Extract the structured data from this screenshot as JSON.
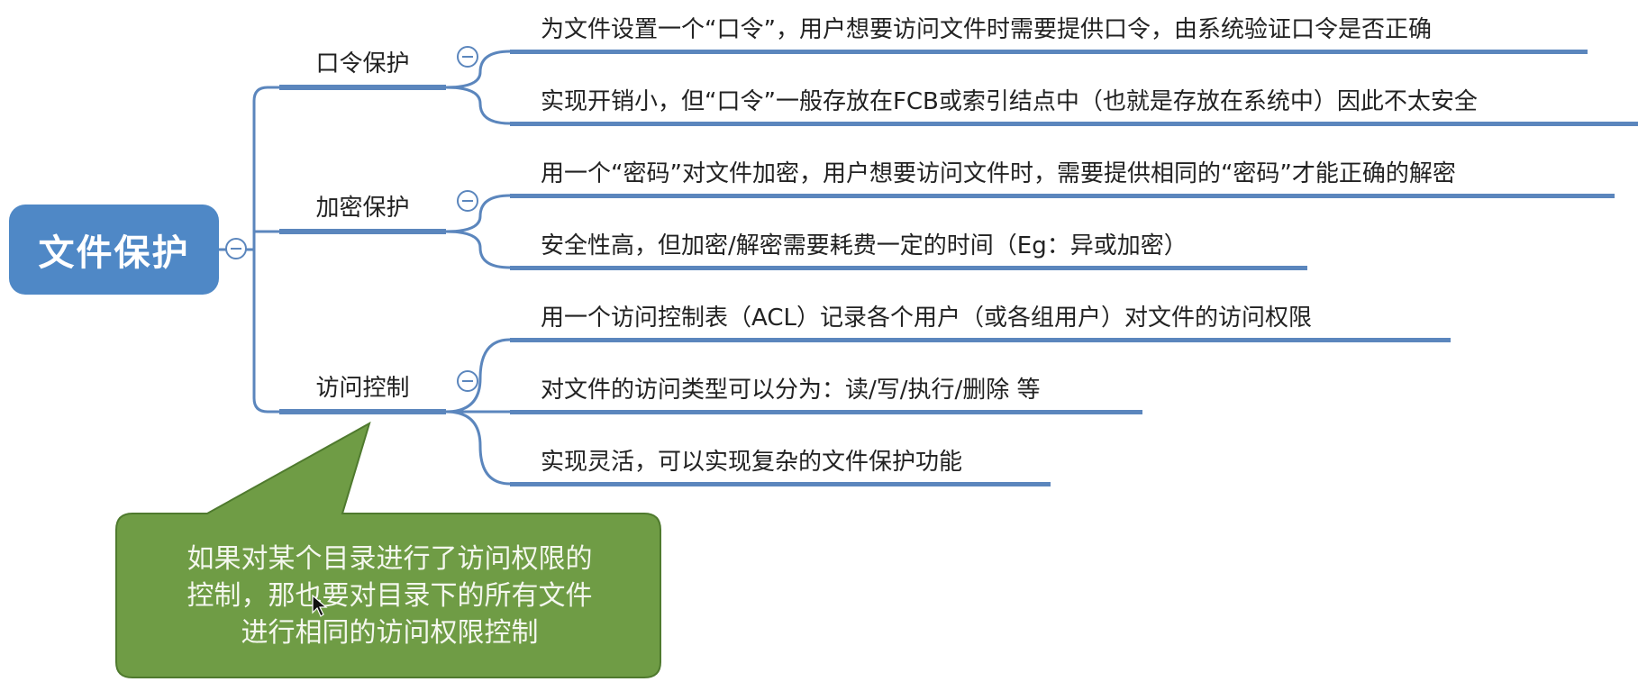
{
  "root": {
    "label": "文件保护"
  },
  "branches": [
    {
      "label": "口令保护",
      "leaves": [
        "为文件设置一个“口令”，用户想要访问文件时需要提供口令，由系统验证口令是否正确",
        "实现开销小，但“口令”一般存放在FCB或索引结点中（也就是存放在系统中）因此不太安全"
      ]
    },
    {
      "label": "加密保护",
      "leaves": [
        "用一个“密码”对文件加密，用户想要访问文件时，需要提供相同的“密码”才能正确的解密",
        "安全性高，但加密/解密需要耗费一定的时间（Eg：异或加密）"
      ]
    },
    {
      "label": "访问控制",
      "leaves": [
        "用一个访问控制表（ACL）记录各个用户（或各组用户）对文件的访问权限",
        "对文件的访问类型可以分为：读/写/执行/删除 等",
        "实现灵活，可以实现复杂的文件保护功能"
      ]
    }
  ],
  "callout": {
    "lines": [
      "如果对某个目录进行了访问权限的",
      "控制，那也要对目录下的所有文件",
      "进行相同的访问权限控制"
    ]
  },
  "colors": {
    "root_fill": "#4f88c6",
    "connector": "#5b86bd",
    "callout_fill": "#6f9c45",
    "callout_stroke": "#4f7a2e"
  }
}
